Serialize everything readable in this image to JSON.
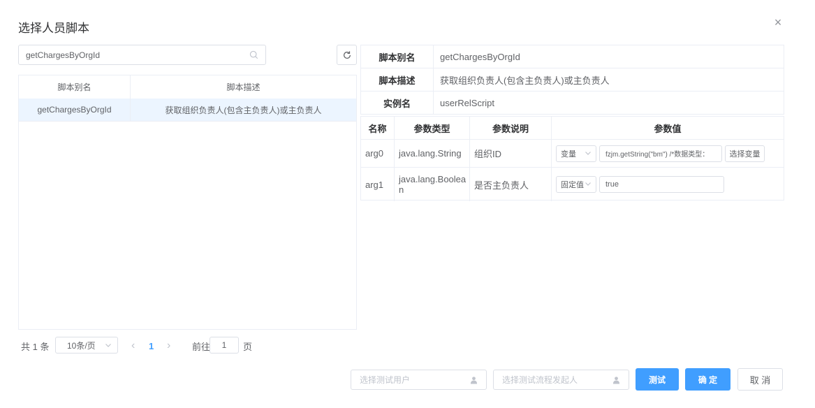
{
  "dialog": {
    "title": "选择人员脚本"
  },
  "search": {
    "value": "getChargesByOrgId"
  },
  "list": {
    "headers": [
      "脚本别名",
      "脚本描述"
    ],
    "rows": [
      {
        "alias": "getChargesByOrgId",
        "desc": "获取组织负责人(包含主负责人)或主负责人"
      }
    ]
  },
  "info": {
    "alias_label": "脚本别名",
    "alias_value": "getChargesByOrgId",
    "desc_label": "脚本描述",
    "desc_value": "获取组织负责人(包含主负责人)或主负责人",
    "instance_label": "实例名",
    "instance_value": "userRelScript"
  },
  "params": {
    "headers": [
      "名称",
      "参数类型",
      "参数说明",
      "参数值"
    ],
    "rows": [
      {
        "name": "arg0",
        "type": "java.lang.String",
        "desc": "组织ID",
        "mode": "变量",
        "value": "fzjm.getString(\"bm\") /*数据类型：",
        "button": "选择变量"
      },
      {
        "name": "arg1",
        "type_line1": "java.lang.Boolea",
        "type_line2": "n",
        "desc": "是否主负责人",
        "mode": "固定值",
        "value": "true"
      }
    ]
  },
  "pagination": {
    "total": "共 1 条",
    "page_size": "10条/页",
    "prev": "‹",
    "current": "1",
    "next": "›",
    "goto_prefix": "前往",
    "goto_value": "1",
    "goto_suffix": "页"
  },
  "footer": {
    "test_user_placeholder": "选择测试用户",
    "test_initiator_placeholder": "选择测试流程发起人",
    "test_button": "测试",
    "confirm_button": "确 定",
    "cancel_button": "取 消"
  },
  "colors": {
    "primary": "#409eff",
    "selected_row": "#ecf5ff",
    "border": "#dcdfe6"
  }
}
